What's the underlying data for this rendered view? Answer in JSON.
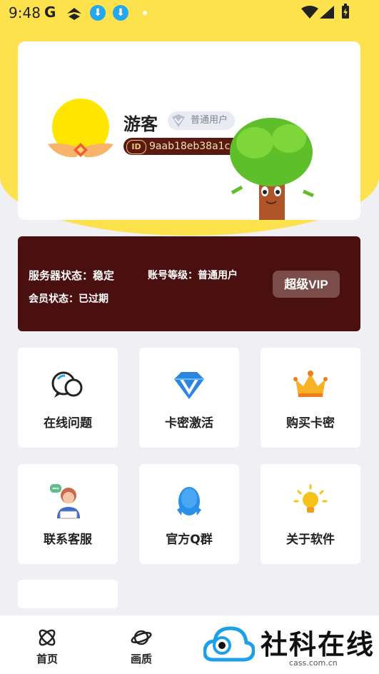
{
  "status_bar": {
    "time": "9:48",
    "g_label": "G"
  },
  "profile": {
    "username": "游客",
    "level_badge": "普通用户",
    "id_tag": "ID",
    "user_id": "9aab18eb38a1ccec"
  },
  "status_card": {
    "server_status": "服务器状态：稳定",
    "account_level": "账号等级：普通用户",
    "member_status": "会员状态：已过期",
    "vip_button": "超级VIP",
    "colors": {
      "background": "#4a0f0f",
      "button": "#7a4d4a"
    }
  },
  "grid": [
    {
      "label": "在线问题",
      "icon": "chat-bubbles-icon"
    },
    {
      "label": "卡密激活",
      "icon": "diamond-icon"
    },
    {
      "label": "购买卡密",
      "icon": "crown-icon"
    },
    {
      "label": "联系客服",
      "icon": "customer-service-icon"
    },
    {
      "label": "官方Q群",
      "icon": "penguin-icon"
    },
    {
      "label": "关于软件",
      "icon": "lightbulb-icon"
    }
  ],
  "bottom_nav": [
    {
      "label": "首页",
      "icon": "atom-icon"
    },
    {
      "label": "画质",
      "icon": "planet-icon"
    }
  ],
  "watermark": {
    "title": "社科在线",
    "url": "cass.com.cn"
  },
  "theme": {
    "accent": "#fde24d"
  }
}
